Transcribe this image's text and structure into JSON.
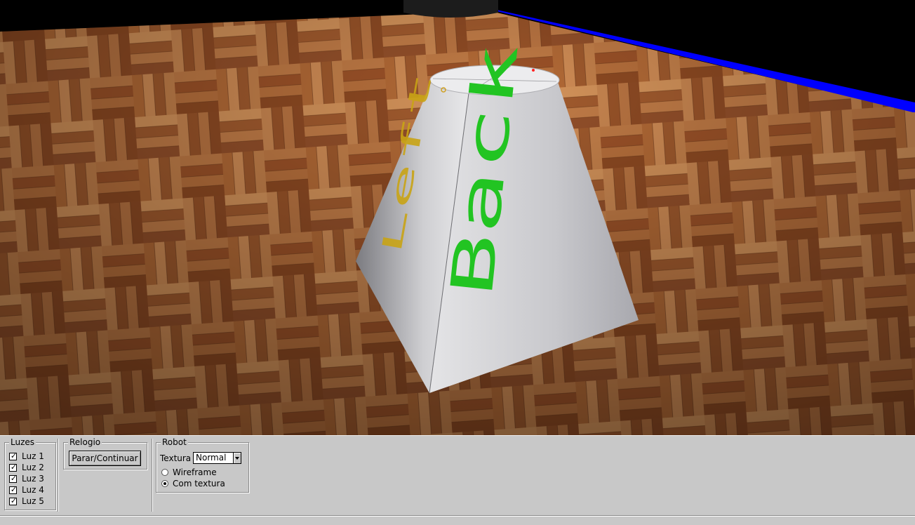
{
  "viewport": {
    "object_faces": [
      {
        "text": "Back",
        "color": "#22c422"
      },
      {
        "text": "Left",
        "color": "#c9a415"
      }
    ],
    "floor_edge_color": "#0000ff"
  },
  "lights_group": {
    "title": "Luzes",
    "items": [
      {
        "label": "Luz 1",
        "checked": true
      },
      {
        "label": "Luz 2",
        "checked": true
      },
      {
        "label": "Luz 3",
        "checked": true
      },
      {
        "label": "Luz 4",
        "checked": true
      },
      {
        "label": "Luz 5",
        "checked": true
      }
    ],
    "check_glyph": "✓"
  },
  "clock_group": {
    "title": "Relogio",
    "button_label": "Parar/Continuar"
  },
  "robot_group": {
    "title": "Robot",
    "texture_label": "Textura",
    "texture_value": "Normal",
    "render_modes": [
      {
        "label": "Wireframe",
        "selected": false
      },
      {
        "label": "Com textura",
        "selected": true
      }
    ]
  }
}
